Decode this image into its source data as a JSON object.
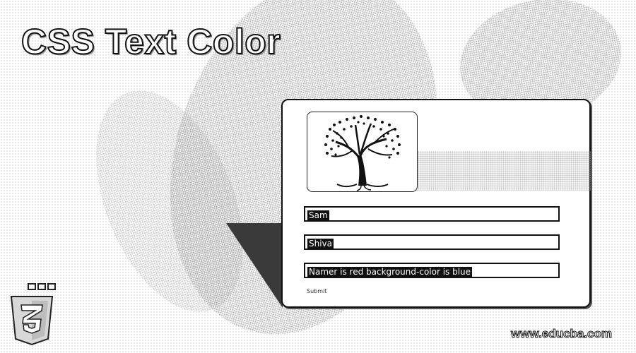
{
  "header": {
    "title": "CSS Text Color"
  },
  "form": {
    "fields": [
      {
        "value": "Sam"
      },
      {
        "value": "Shiva"
      },
      {
        "value": "Namer is  red  background-color is   blue"
      }
    ],
    "submit_label": "Submit"
  },
  "icons": {
    "tree": "tree-icon",
    "logo": "css3-logo-icon"
  },
  "footer": {
    "url": "www.educba.com"
  }
}
